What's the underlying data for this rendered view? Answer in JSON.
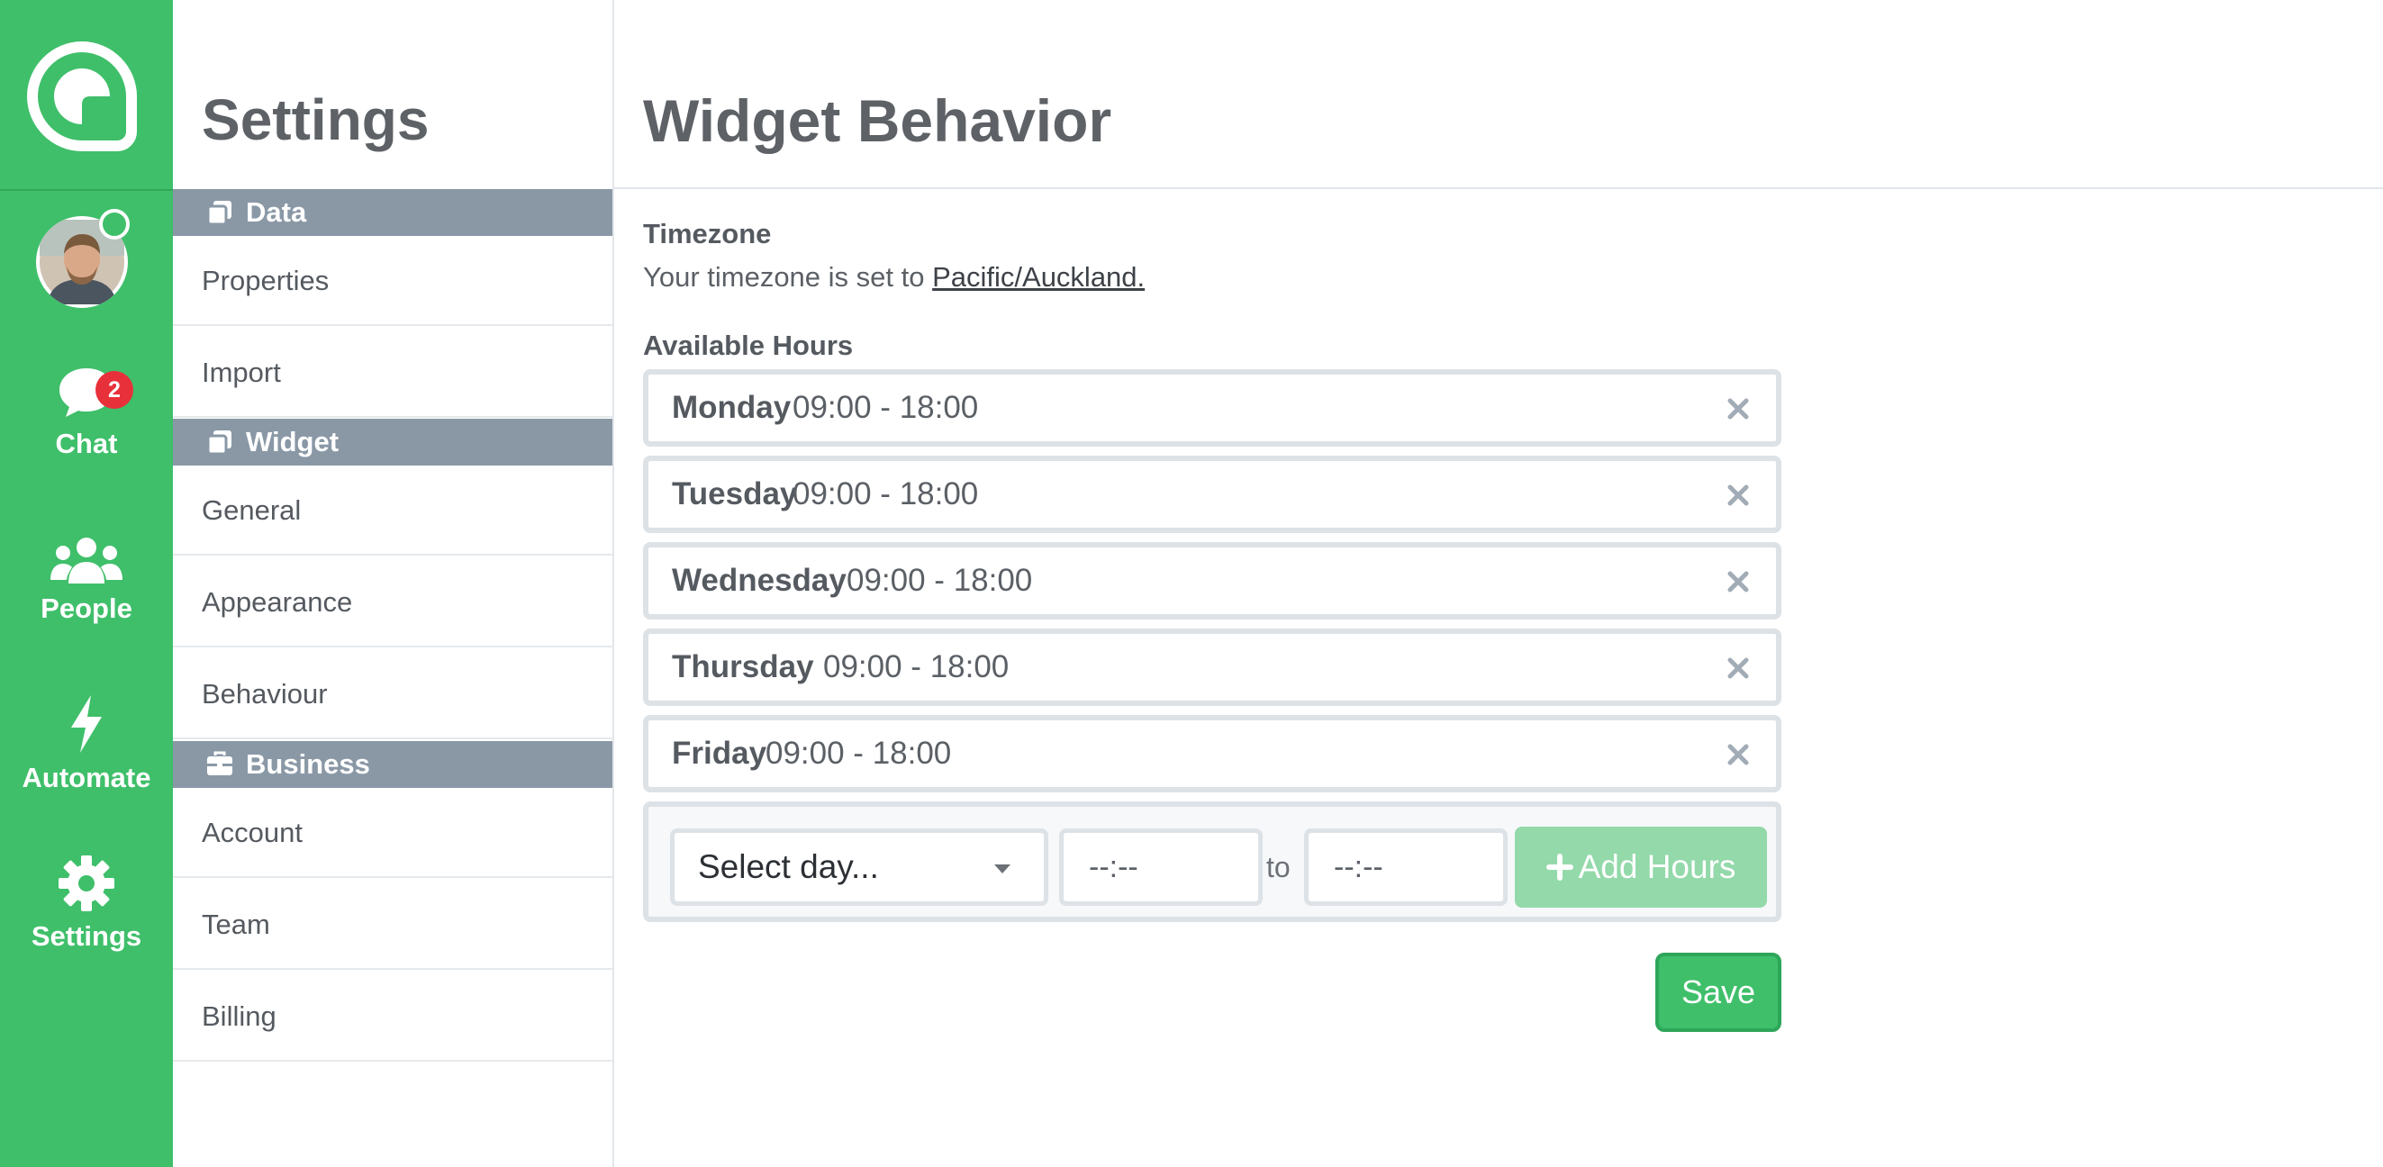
{
  "nav": {
    "items": [
      {
        "label": "Chat",
        "badge": "2"
      },
      {
        "label": "People"
      },
      {
        "label": "Automate"
      },
      {
        "label": "Settings"
      }
    ]
  },
  "settings": {
    "heading": "Settings",
    "sections": [
      {
        "title": "Data",
        "items": [
          "Properties",
          "Import"
        ]
      },
      {
        "title": "Widget",
        "items": [
          "General",
          "Appearance",
          "Behaviour"
        ]
      },
      {
        "title": "Business",
        "items": [
          "Account",
          "Team",
          "Billing"
        ]
      }
    ]
  },
  "main": {
    "title": "Widget Behavior",
    "timezone": {
      "label": "Timezone",
      "text": "Your timezone is set to ",
      "link": "Pacific/Auckland."
    },
    "hours": {
      "label": "Available Hours",
      "rows": [
        {
          "day": "Monday",
          "time": "09:00 - 18:00"
        },
        {
          "day": "Tuesday",
          "time": "09:00 - 18:00"
        },
        {
          "day": "Wednesday",
          "time": "09:00 - 18:00"
        },
        {
          "day": "Thursday",
          "time": "09:00 - 18:00"
        },
        {
          "day": "Friday",
          "time": "09:00 - 18:00"
        }
      ],
      "add": {
        "select_placeholder": "Select day...",
        "from_value": "--:--",
        "to_label": "to",
        "to_value": "--:--",
        "button_label": "Add Hours"
      }
    },
    "save_label": "Save"
  },
  "colors": {
    "brand_green": "#3fbf6a",
    "section_gray": "#8a98a6",
    "badge_red": "#e8303a",
    "add_button_disabled": "#93d9aa"
  }
}
